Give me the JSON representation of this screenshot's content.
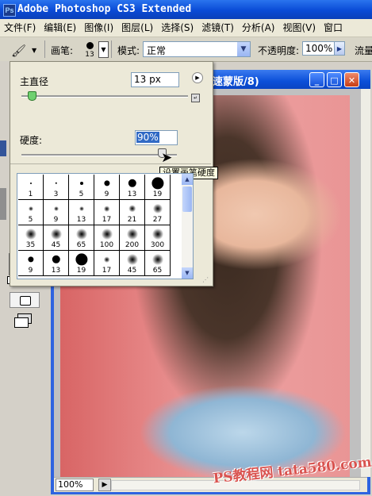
{
  "titlebar": {
    "title": "Adobe Photoshop CS3 Extended",
    "icon_letters": "Ps"
  },
  "menu": {
    "items": [
      "文件(F)",
      "编辑(E)",
      "图像(I)",
      "图层(L)",
      "选择(S)",
      "滤镜(T)",
      "分析(A)",
      "视图(V)",
      "窗口"
    ]
  },
  "options": {
    "brush_label": "画笔:",
    "brush_size": "13",
    "mode_label": "模式:",
    "mode_value": "正常",
    "opacity_label": "不透明度:",
    "opacity_value": "100%",
    "flow_label": "流量"
  },
  "brush_picker": {
    "diameter_label": "主直径",
    "diameter_value": "13 px",
    "hardness_label": "硬度:",
    "hardness_value": "90%",
    "tooltip": "设置画笔硬度",
    "presets": [
      {
        "size": "1",
        "soft": false
      },
      {
        "size": "3",
        "soft": false
      },
      {
        "size": "5",
        "soft": false
      },
      {
        "size": "9",
        "soft": false
      },
      {
        "size": "13",
        "soft": false
      },
      {
        "size": "19",
        "soft": false
      },
      {
        "size": "5",
        "soft": true
      },
      {
        "size": "9",
        "soft": true
      },
      {
        "size": "13",
        "soft": true
      },
      {
        "size": "17",
        "soft": true
      },
      {
        "size": "21",
        "soft": true
      },
      {
        "size": "27",
        "soft": true
      },
      {
        "size": "35",
        "soft": true
      },
      {
        "size": "45",
        "soft": true
      },
      {
        "size": "65",
        "soft": true
      },
      {
        "size": "100",
        "soft": true
      },
      {
        "size": "200",
        "soft": true
      },
      {
        "size": "300",
        "soft": true
      },
      {
        "size": "9",
        "soft": false
      },
      {
        "size": "13",
        "soft": false
      },
      {
        "size": "19",
        "soft": false
      },
      {
        "size": "17",
        "soft": true
      },
      {
        "size": "45",
        "soft": true
      },
      {
        "size": "65",
        "soft": true
      }
    ]
  },
  "document": {
    "title": "速蒙版/8)",
    "zoom": "100%",
    "watermark": "PS教程网 tata580.com"
  },
  "colors": {
    "titlebar": "#0a4bd6",
    "foreground": "#000000",
    "background": "#ffffff",
    "selection": "#316ac5"
  },
  "icons": {
    "brush_tool": "brush-icon",
    "hand_tool": "hand-icon",
    "zoom_tool": "magnifier-icon",
    "cursor": "arrow-cursor-icon"
  }
}
